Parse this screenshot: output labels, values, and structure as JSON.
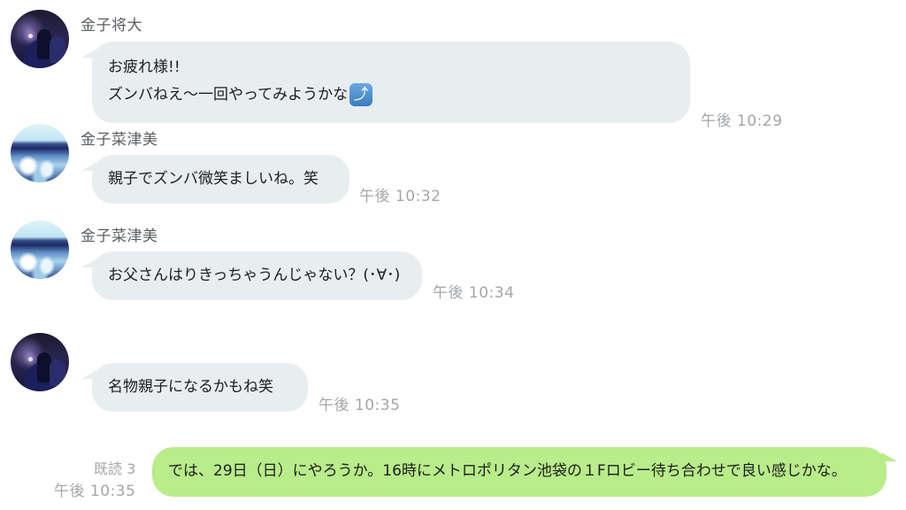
{
  "messages": [
    {
      "sender": "金子将大",
      "avatar": "night-photo-avatar",
      "lines": [
        "お疲れ様!!",
        "ズンバねえ〜一回やってみようかな"
      ],
      "emoji": "⤴",
      "time": "午後 10:29"
    },
    {
      "sender": "金子菜津美",
      "avatar": "sea-photo-avatar",
      "text": "親子でズンバ微笑ましいね。笑",
      "time": "午後 10:32"
    },
    {
      "sender": "金子菜津美",
      "avatar": "sea-photo-avatar",
      "text": "お父さんはりきっちゃうんじゃない？(･∀･)",
      "time": "午後 10:34"
    },
    {
      "avatar": "night-photo-avatar",
      "text": "名物親子になるかもね笑",
      "time": "午後 10:35"
    },
    {
      "outgoing": true,
      "read_label": "既読 3",
      "text": "では、29日（日）にやろうか。16時にメトロポリタン池袋の１Fロビー待ち合わせで良い感じかな。",
      "time": "午後 10:35"
    }
  ],
  "colors": {
    "incoming_bubble": "#e8edef",
    "outgoing_bubble": "#b9ec8a",
    "timestamp": "#a2a6a9",
    "sender_name": "#5a5f63"
  }
}
